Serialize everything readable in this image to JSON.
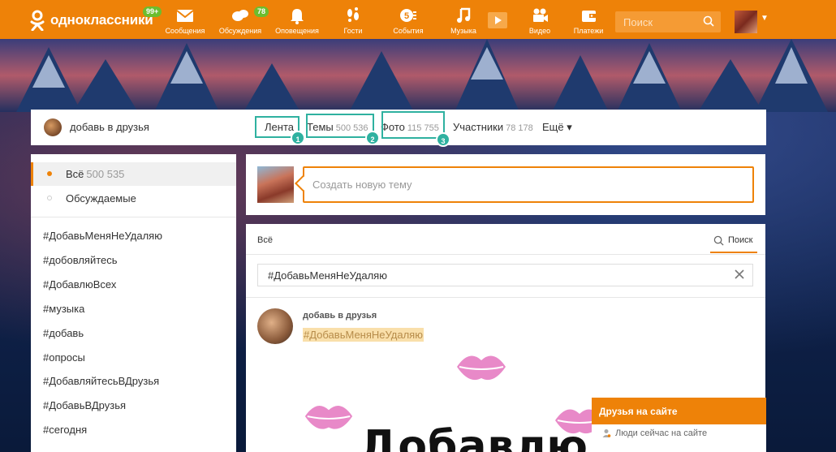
{
  "brand": {
    "name": "одноклассники",
    "color": "#ee8208",
    "badge_color": "#6cbd2e"
  },
  "topnav": {
    "logo_badge": "99+",
    "items": [
      {
        "label": "Сообщения",
        "icon": "envelope-icon",
        "badge": ""
      },
      {
        "label": "Обсуждения",
        "icon": "chat-bubbles-icon",
        "badge": "78"
      },
      {
        "label": "Оповещения",
        "icon": "bell-icon",
        "badge": ""
      },
      {
        "label": "Гости",
        "icon": "footprints-icon",
        "badge": ""
      },
      {
        "label": "События",
        "icon": "events-five-icon",
        "badge": ""
      },
      {
        "label": "Музыка",
        "icon": "music-note-icon",
        "badge": ""
      },
      {
        "label": "Видео",
        "icon": "video-camera-icon",
        "badge": ""
      },
      {
        "label": "Платежи",
        "icon": "wallet-icon",
        "badge": ""
      }
    ],
    "search_placeholder": "Поиск"
  },
  "group": {
    "name": "добавь в друзья",
    "tabs": [
      {
        "label": "Лента",
        "count": ""
      },
      {
        "label": "Темы",
        "count": "500 536"
      },
      {
        "label": "Фото",
        "count": "115 755"
      },
      {
        "label": "Участники",
        "count": "78 178"
      },
      {
        "label": "Ещё ▾",
        "count": ""
      }
    ],
    "highlight_numbers": [
      "1",
      "2",
      "3"
    ],
    "highlight_color": "#2fb1a0"
  },
  "sidebar": {
    "filters": [
      {
        "label": "Всё",
        "count": "500 535",
        "active": true
      },
      {
        "label": "Обсуждаемые",
        "count": "",
        "active": false
      }
    ],
    "hashtags": [
      "#ДобавьМеняНеУдаляю",
      "#добовляйтесь",
      "#ДобавлюВсех",
      "#музыка",
      "#добавь",
      "#опросы",
      "#ДобавляйтесьВДрузья",
      "#ДобавьВДрузья",
      "#сегодня"
    ]
  },
  "composer": {
    "placeholder": "Создать новую тему"
  },
  "feed": {
    "tab_all": "Всё",
    "search_label": "Поиск",
    "filter_value": "#ДобавьМеняНеУдаляю",
    "post": {
      "author": "добавь в друзья",
      "hashtag": "#ДобавьМеняНеУдаляю",
      "image_text": "Добавлю"
    }
  },
  "friends_online": {
    "title": "Друзья на сайте",
    "subtitle": "Люди сейчас на сайте"
  }
}
